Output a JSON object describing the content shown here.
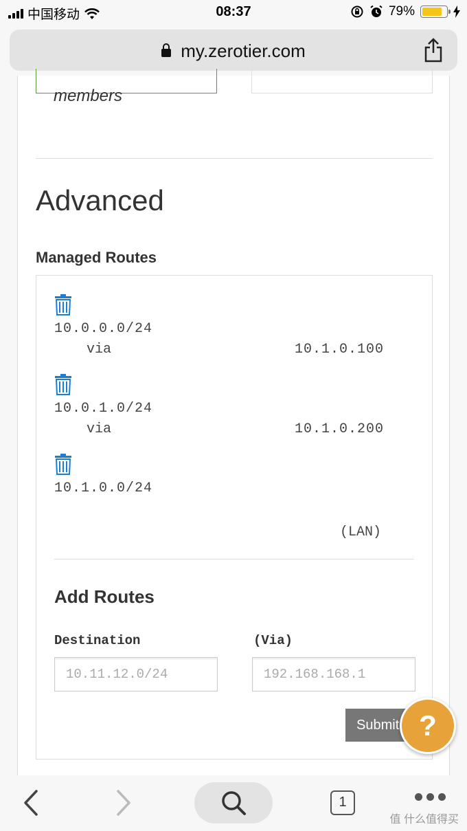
{
  "status_bar": {
    "carrier": "中国移动",
    "time": "08:37",
    "battery": "79%"
  },
  "browser": {
    "url": "my.zerotier.com"
  },
  "page": {
    "members_label": "members",
    "advanced_heading": "Advanced",
    "managed_routes_heading": "Managed Routes",
    "routes": [
      {
        "destination": "10.0.0.0/24",
        "via_label": "via",
        "gateway": "10.1.0.100"
      },
      {
        "destination": "10.0.1.0/24",
        "via_label": "via",
        "gateway": "10.1.0.200"
      },
      {
        "destination": "10.1.0.0/24",
        "note": "(LAN)"
      }
    ],
    "add_routes": {
      "heading": "Add Routes",
      "destination_label": "Destination",
      "via_label": "(Via)",
      "destination_placeholder": "10.11.12.0/24",
      "via_placeholder": "192.168.168.1",
      "submit_label": "Submit"
    },
    "help_label": "?"
  },
  "toolbar": {
    "tab_count": "1",
    "watermark": "值 什么值得买"
  },
  "colors": {
    "accent_blue": "#1a7fd4",
    "help_orange": "#e8a23a",
    "submit_gray": "#777777",
    "members_border_green": "#5a9a3a"
  }
}
